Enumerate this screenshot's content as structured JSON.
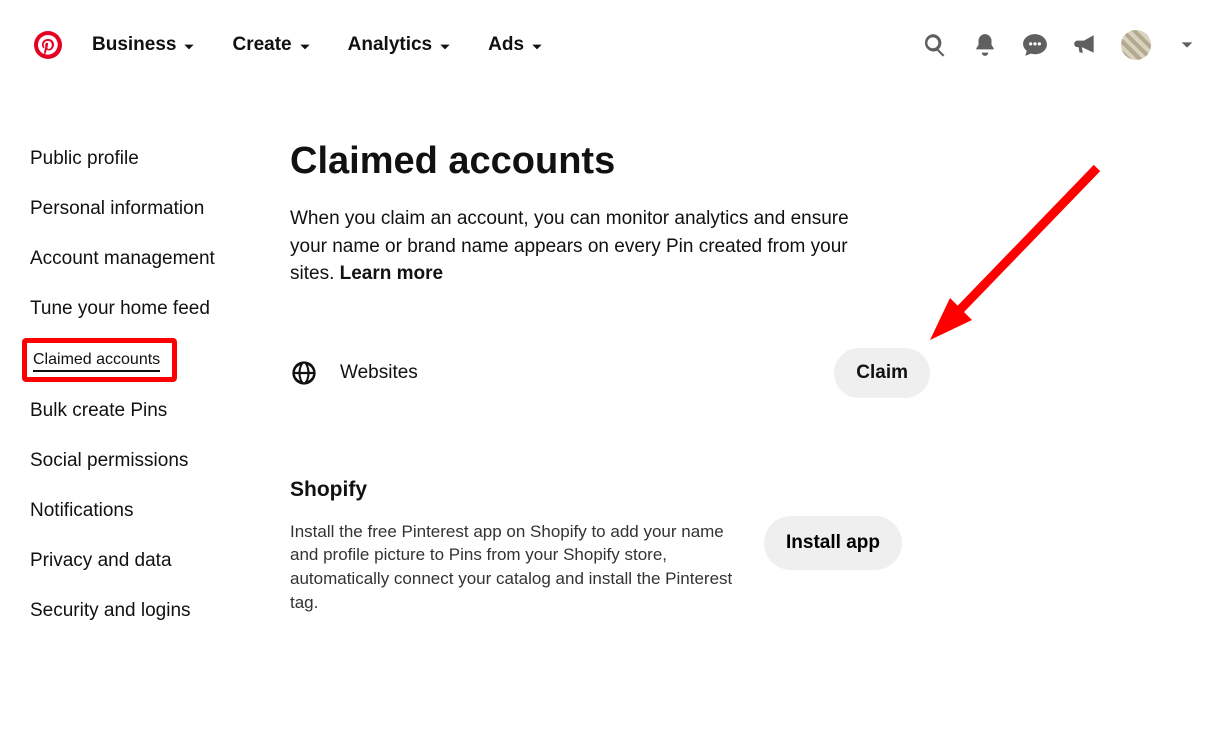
{
  "nav": {
    "items": [
      "Business",
      "Create",
      "Analytics",
      "Ads"
    ]
  },
  "sidebar": {
    "items": [
      "Public profile",
      "Personal information",
      "Account management",
      "Tune your home feed",
      "Claimed accounts",
      "Bulk create Pins",
      "Social permissions",
      "Notifications",
      "Privacy and data",
      "Security and logins"
    ],
    "active_index": 4
  },
  "main": {
    "title": "Claimed accounts",
    "description": "When you claim an account, you can monitor analytics and ensure your name or brand name appears on every Pin created from your sites. ",
    "learn_more": "Learn more",
    "websites_label": "Websites",
    "claim_button": "Claim",
    "shopify": {
      "title": "Shopify",
      "description": "Install the free Pinterest app on Shopify to add your name and profile picture to Pins from your Shopify store, automatically connect your catalog and install the Pinterest tag.",
      "button": "Install app"
    }
  },
  "colors": {
    "brand": "#e60023",
    "highlight": "#ff0000",
    "pill": "#efefef"
  }
}
